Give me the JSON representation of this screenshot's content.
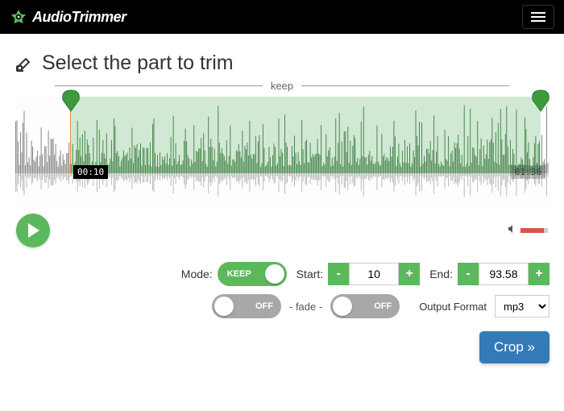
{
  "brand": "AudioTrimmer",
  "title": "Select the part to trim",
  "divider_label": "keep",
  "time_start_label": "00:10",
  "time_end_label": "01:36",
  "mode": {
    "label": "Mode:",
    "toggle_text": "KEEP"
  },
  "start": {
    "label": "Start:",
    "value": "10",
    "minus": "-",
    "plus": "+"
  },
  "end": {
    "label": "End:",
    "value": "93.58",
    "minus": "-",
    "plus": "+"
  },
  "fade": {
    "left_toggle": "OFF",
    "label": "- fade -",
    "right_toggle": "OFF"
  },
  "output": {
    "label": "Output Format",
    "selected": "mp3"
  },
  "crop_label": "Crop »"
}
